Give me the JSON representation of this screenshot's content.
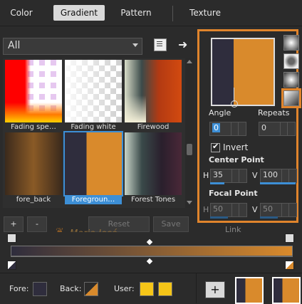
{
  "tabs": [
    {
      "label": "Color"
    },
    {
      "label": "Gradient"
    },
    {
      "label": "Pattern"
    },
    {
      "label": "Texture"
    }
  ],
  "filter": {
    "value": "All"
  },
  "presets": [
    {
      "label": "Fading spe…"
    },
    {
      "label": "Fading white"
    },
    {
      "label": "Firewood"
    },
    {
      "label": "fore_back"
    },
    {
      "label": "Foregroun…"
    },
    {
      "label": "Forest Tones"
    }
  ],
  "actions": {
    "add": "+",
    "remove": "-",
    "reset": "Reset",
    "save": "Save",
    "link": "Link"
  },
  "watermark": "Maria José",
  "settings": {
    "angle_label": "Angle",
    "angle_value": "0",
    "repeats_label": "Repeats",
    "repeats_value": "0",
    "invert_label": "Invert",
    "center_label": "Center Point",
    "center_h_label": "H",
    "center_h": "35",
    "center_v_label": "V",
    "center_v": "100",
    "focal_label": "Focal Point",
    "focal_h_label": "H",
    "focal_h": "50",
    "focal_v_label": "V",
    "focal_v": "50"
  },
  "bottom": {
    "fore_label": "Fore:",
    "back_label": "Back:",
    "user_label": "User:",
    "add_label": "+"
  },
  "colors": {
    "fore": "#2f2d3d",
    "back": "#d98a2c",
    "accent": "#e0842c",
    "selection": "#3d8fd6",
    "user1": "#f5c518",
    "user2": "#f5c518"
  }
}
